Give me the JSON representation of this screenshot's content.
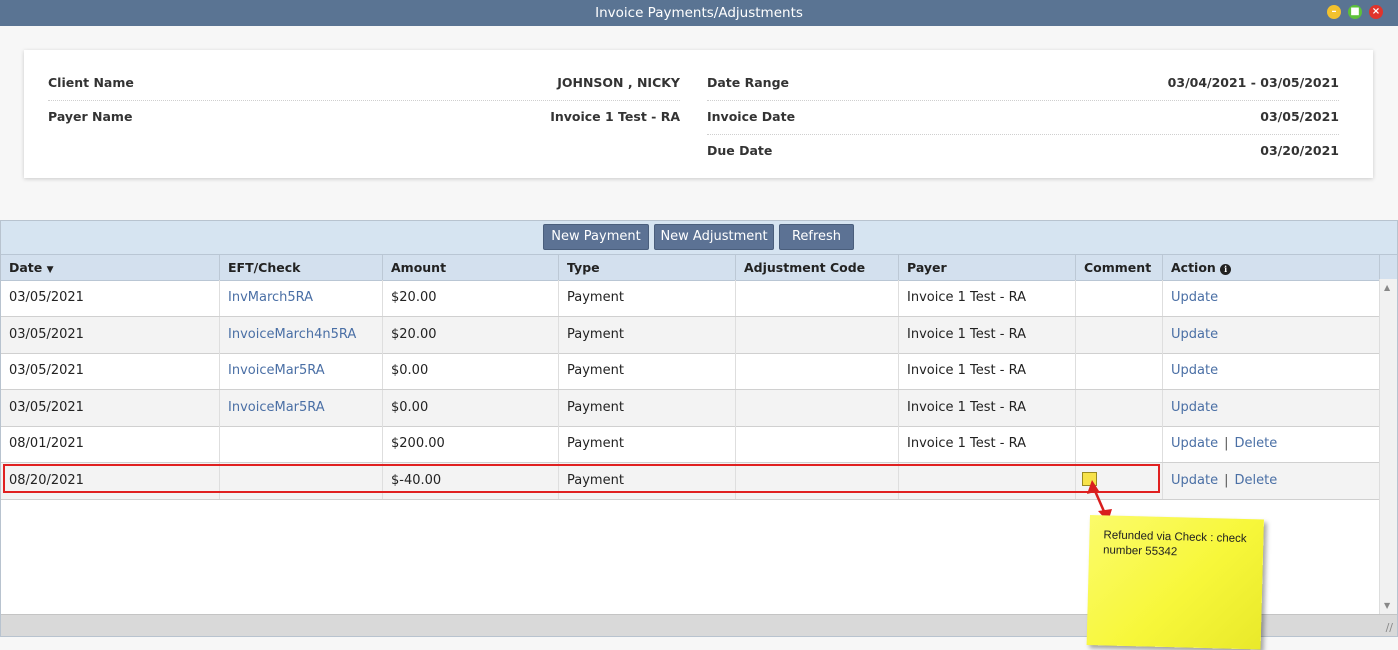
{
  "window": {
    "title": "Invoice Payments/Adjustments"
  },
  "info": {
    "client_name_label": "Client Name",
    "client_name_value": "JOHNSON , NICKY",
    "payer_name_label": "Payer Name",
    "payer_name_value": "Invoice 1 Test - RA",
    "date_range_label": "Date Range",
    "date_range_value": "03/04/2021 - 03/05/2021",
    "invoice_date_label": "Invoice Date",
    "invoice_date_value": "03/05/2021",
    "due_date_label": "Due Date",
    "due_date_value": "03/20/2021"
  },
  "toolbar": {
    "new_payment": "New Payment",
    "new_adjustment": "New Adjustment",
    "refresh": "Refresh"
  },
  "columns": {
    "date": "Date",
    "eft": "EFT/Check",
    "amount": "Amount",
    "type": "Type",
    "adj_code": "Adjustment Code",
    "payer": "Payer",
    "comment": "Comment",
    "action": "Action"
  },
  "rows": [
    {
      "date": "03/05/2021",
      "eft": "InvMarch5RA",
      "amount": "$20.00",
      "type": "Payment",
      "adj_code": "",
      "payer": "Invoice 1 Test - RA",
      "update": "Update",
      "delete": ""
    },
    {
      "date": "03/05/2021",
      "eft": "InvoiceMarch4n5RA",
      "amount": "$20.00",
      "type": "Payment",
      "adj_code": "",
      "payer": "Invoice 1 Test - RA",
      "update": "Update",
      "delete": ""
    },
    {
      "date": "03/05/2021",
      "eft": "InvoiceMar5RA",
      "amount": "$0.00",
      "type": "Payment",
      "adj_code": "",
      "payer": "Invoice 1 Test - RA",
      "update": "Update",
      "delete": ""
    },
    {
      "date": "03/05/2021",
      "eft": "InvoiceMar5RA",
      "amount": "$0.00",
      "type": "Payment",
      "adj_code": "",
      "payer": "Invoice 1 Test - RA",
      "update": "Update",
      "delete": ""
    },
    {
      "date": "08/01/2021",
      "eft": "",
      "amount": "$200.00",
      "type": "Payment",
      "adj_code": "",
      "payer": "Invoice 1 Test - RA",
      "update": "Update",
      "delete": "Delete"
    },
    {
      "date": "08/20/2021",
      "eft": "",
      "amount": "$-40.00",
      "type": "Payment",
      "adj_code": "",
      "payer": "",
      "update": "Update",
      "delete": "Delete"
    }
  ],
  "comment_note": "Refunded via Check : check number 55342",
  "colors": {
    "titlebar": "#5a7493",
    "button": "#5c7294",
    "link": "#4a6fa5",
    "highlight": "#e02020",
    "note": "#f7f73a"
  }
}
